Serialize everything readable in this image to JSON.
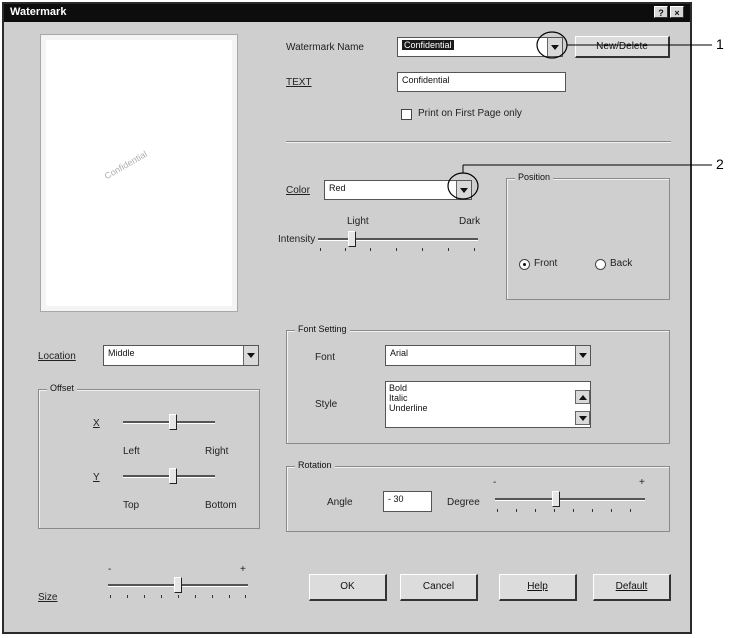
{
  "window": {
    "title": "Watermark",
    "help_glyph": "?",
    "close_glyph": "×"
  },
  "preview": {
    "sample_text": "Confidential"
  },
  "watermark_name": {
    "label": "Watermark Name",
    "value": "Confidential",
    "button": "New/Delete"
  },
  "text_field": {
    "label": "TEXT",
    "value": "Confidential"
  },
  "first_page": {
    "label": "Print on First Page only",
    "checked": false
  },
  "color": {
    "label": "Color",
    "value": "Red"
  },
  "intensity": {
    "label": "Intensity",
    "light": "Light",
    "dark": "Dark",
    "level": 0.2
  },
  "position": {
    "group": "Position",
    "front": "Front",
    "back": "Back",
    "selected": "Front"
  },
  "location": {
    "label": "Location",
    "value": "Middle"
  },
  "offset": {
    "group": "Offset",
    "x_label": "X",
    "x_left": "Left",
    "x_right": "Right",
    "x_level": 0.55,
    "y_label": "Y",
    "y_top": "Top",
    "y_bottom": "Bottom",
    "y_level": 0.55
  },
  "font_setting": {
    "group": "Font Setting",
    "font_label": "Font",
    "font_value": "Arial",
    "style_label": "Style",
    "styles": [
      "Bold",
      "Italic",
      "Underline"
    ]
  },
  "rotation": {
    "group": "Rotation",
    "angle_label": "Angle",
    "angle_value": "- 30",
    "degree_label": "Degree",
    "minus": "-",
    "plus": "+",
    "level": 0.4
  },
  "size": {
    "label": "Size",
    "minus": "-",
    "plus": "+",
    "level": 0.5
  },
  "buttons": {
    "ok": "OK",
    "cancel": "Cancel",
    "help": "Help",
    "default": "Default"
  },
  "callouts": {
    "one": "1",
    "two": "2"
  }
}
